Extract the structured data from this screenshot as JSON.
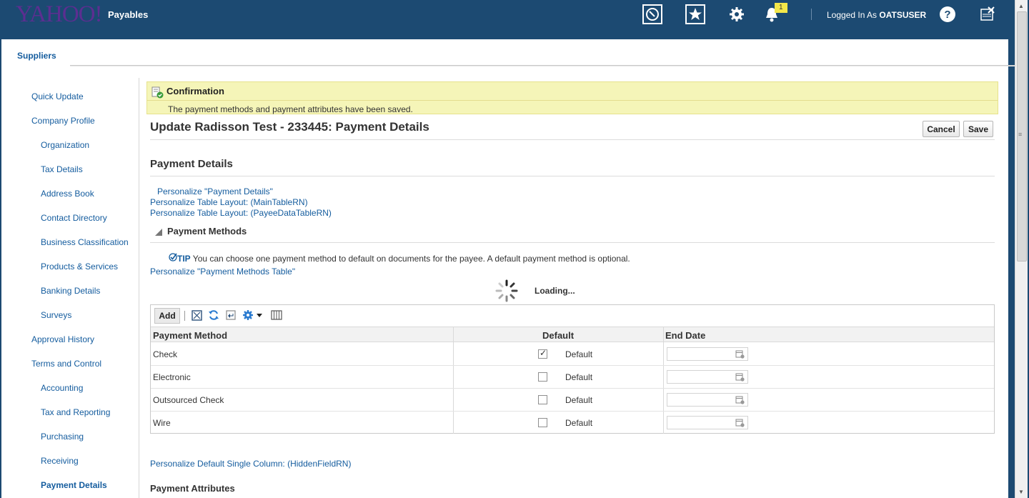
{
  "header": {
    "logo": "YAHOO!",
    "app_name": "Payables",
    "notification_count": "1",
    "logged_in_prefix": "Logged In As",
    "username": "OATSUSER",
    "icons": [
      "compass-icon",
      "favorites-star-icon",
      "settings-gear-icon",
      "notifications-bell-icon",
      "help-icon",
      "close-window-icon"
    ]
  },
  "tabs": {
    "suppliers": "Suppliers"
  },
  "sidebar": {
    "items": [
      {
        "label": "Quick Update",
        "level": 1
      },
      {
        "label": "Company Profile",
        "level": 1
      },
      {
        "label": "Organization",
        "level": 2
      },
      {
        "label": "Tax Details",
        "level": 2
      },
      {
        "label": "Address Book",
        "level": 2
      },
      {
        "label": "Contact Directory",
        "level": 2
      },
      {
        "label": "Business Classification",
        "level": 2
      },
      {
        "label": "Products & Services",
        "level": 2
      },
      {
        "label": "Banking Details",
        "level": 2
      },
      {
        "label": "Surveys",
        "level": 2
      },
      {
        "label": "Approval History",
        "level": 1
      },
      {
        "label": "Terms and Control",
        "level": 1
      },
      {
        "label": "Accounting",
        "level": 2
      },
      {
        "label": "Tax and Reporting",
        "level": 2
      },
      {
        "label": "Purchasing",
        "level": 2
      },
      {
        "label": "Receiving",
        "level": 2
      },
      {
        "label": "Payment Details",
        "level": 2,
        "active": true
      }
    ]
  },
  "confirmation": {
    "title": "Confirmation",
    "message": "The payment methods and payment attributes have been saved."
  },
  "page": {
    "title": "Update Radisson Test - 233445: Payment Details",
    "cancel_label": "Cancel",
    "save_label": "Save",
    "section_title": "Payment Details",
    "personalize_links": [
      "Personalize \"Payment Details\"",
      "Personalize Table Layout: (MainTableRN)",
      "Personalize Table Layout: (PayeeDataTableRN)"
    ],
    "methods_title": "Payment Methods",
    "tip_label": "TIP",
    "tip_text": "You can choose one payment method to default on documents for the payee. A default payment method is optional.",
    "personalize_methods_table": "Personalize \"Payment Methods Table\"",
    "loading_text": "Loading...",
    "personalize_hidden": "Personalize Default Single Column: (HiddenFieldRN)",
    "attributes_title": "Payment Attributes"
  },
  "table": {
    "add_label": "Add",
    "columns": [
      "Payment Method",
      "Default",
      "End Date"
    ],
    "rows": [
      {
        "method": "Check",
        "default_checked": true,
        "default_label": "Default",
        "end_date": ""
      },
      {
        "method": "Electronic",
        "default_checked": false,
        "default_label": "Default",
        "end_date": ""
      },
      {
        "method": "Outsourced Check",
        "default_checked": false,
        "default_label": "Default",
        "end_date": ""
      },
      {
        "method": "Wire",
        "default_checked": false,
        "default_label": "Default",
        "end_date": ""
      }
    ]
  },
  "colors": {
    "header_bg": "#1c4a72",
    "link": "#145c9e",
    "confirmation_bg": "#f5f5b8",
    "logo": "#5c2e91"
  }
}
